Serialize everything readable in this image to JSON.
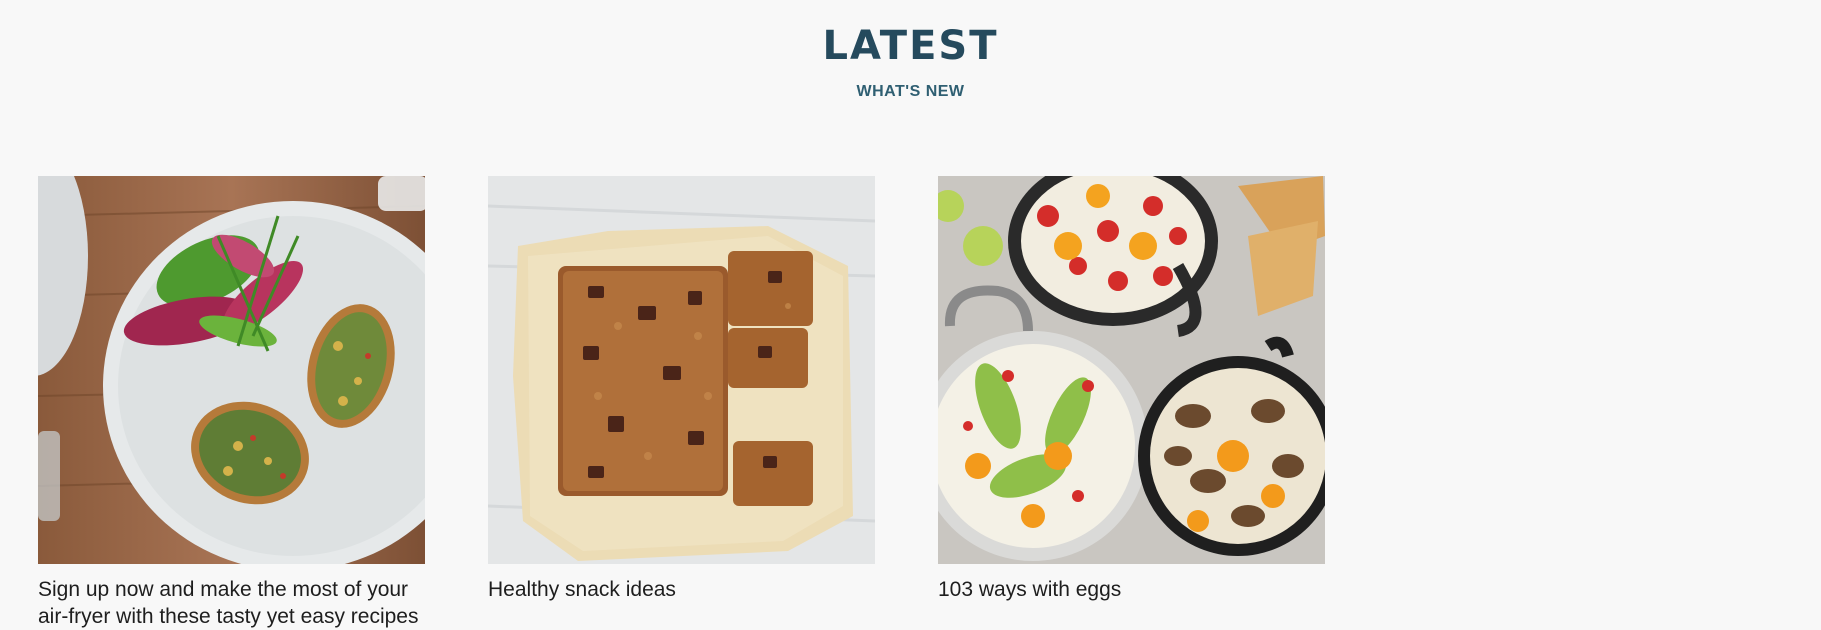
{
  "section": {
    "title": "LATEST",
    "subtitle": "WHAT'S NEW"
  },
  "cards": [
    {
      "caption": "Sign up now and make the most of your air-fryer with these tasty yet easy recipes",
      "image_subject": "stuffed baked potatoes with radicchio salad on a plate"
    },
    {
      "caption": "Healthy snack ideas",
      "image_subject": "oat and chocolate flapjack slices on baking paper"
    },
    {
      "caption": "103 ways with eggs",
      "image_subject": "shakshuka-style baked egg pans with toast"
    }
  ]
}
